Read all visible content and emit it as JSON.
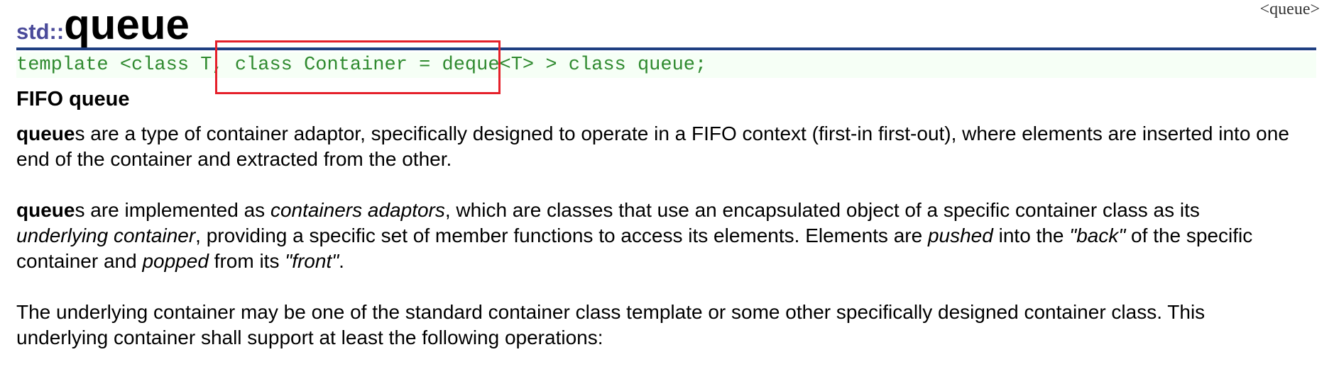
{
  "header": {
    "include": "<queue>"
  },
  "title": {
    "namespace": "std::",
    "name": "queue"
  },
  "prototype": {
    "before": "template <class T, ",
    "highlighted": "class Container = deque<T>",
    "after": " > class queue;"
  },
  "section_title": "FIFO queue",
  "para1": {
    "term": "queue",
    "text": "s are a type of container adaptor, specifically designed to operate in a FIFO context (first-in first-out), where elements are inserted into one end of the container and extracted from the other."
  },
  "para2": {
    "term": "queue",
    "t1": "s are implemented as ",
    "i1": "containers adaptors",
    "t2": ", which are classes that use an encapsulated object of a specific container class as its ",
    "i2": "underlying container",
    "t3": ", providing a specific set of member functions to access its elements. Elements are ",
    "i3": "pushed",
    "t4": " into the ",
    "i4": "\"back\"",
    "t5": " of the specific container and ",
    "i5": "popped",
    "t6": " from its ",
    "i6": "\"front\"",
    "t7": "."
  },
  "para3": {
    "text": "The underlying container may be one of the standard container class template or some other specifically designed container class. This underlying container shall support at least the following operations:"
  },
  "colors": {
    "namespace": "#4b4b9a",
    "rule": "#1f3f82",
    "code": "#2f8a2f",
    "highlight_border": "#e5202a"
  }
}
